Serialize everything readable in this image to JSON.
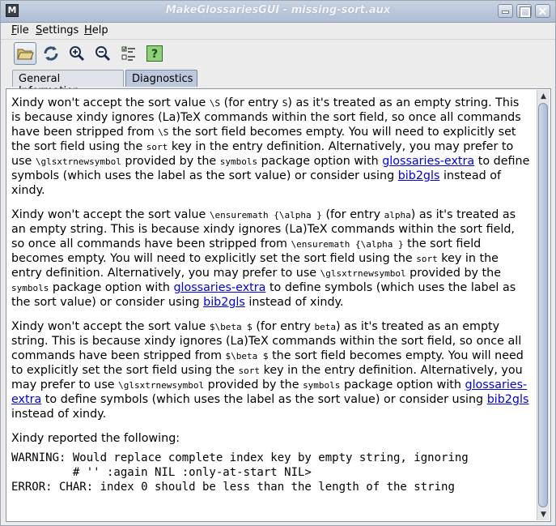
{
  "window": {
    "title": "MakeGlossariesGUI - missing-sort.aux",
    "app_icon": "M"
  },
  "menu": [
    {
      "label": "File",
      "mnemonic": "F",
      "rest": "ile"
    },
    {
      "label": "Settings",
      "mnemonic": "S",
      "rest": "ettings"
    },
    {
      "label": "Help",
      "mnemonic": "H",
      "rest": "elp"
    }
  ],
  "toolbar": {
    "icons": [
      "open-folder-icon",
      "reload-icon",
      "zoom-in-icon",
      "zoom-out-icon",
      "properties-icon",
      "help-icon"
    ],
    "help_glyph": "?"
  },
  "tabs": {
    "general": "General Information",
    "diagnostics": "Diagnostics"
  },
  "diagnostics": {
    "p1": {
      "a": "Xindy won't accept the sort value ",
      "c1": "\\S",
      "b": " (for entry ",
      "c2": "S",
      "c": ") as it's treated as an empty string. This is because xindy ignores (La)TeX commands within the sort field, so once all commands have been stripped from ",
      "c3": "\\S",
      "d": " the sort field becomes empty. You will need to explicitly set the sort field using the ",
      "c4": "sort",
      "e": " key in the entry definition. Alternatively, you may prefer to use ",
      "c5": "\\glsxtrnewsymbol",
      "f": " provided by the ",
      "c6": "symbols",
      "g": " package option with ",
      "link1": "glossaries-extra",
      "h": " to define symbols (which uses the label as the sort value) or consider using ",
      "link2": "bib2gls",
      "i": " instead of xindy."
    },
    "p2": {
      "a": "Xindy won't accept the sort value ",
      "c1": "\\ensuremath {\\alpha }",
      "b": " (for entry ",
      "c2": "alpha",
      "c": ") as it's treated as an empty string. This is because xindy ignores (La)TeX commands within the sort field, so once all commands have been stripped from ",
      "c3": "\\ensuremath {\\alpha }",
      "d": " the sort field becomes empty. You will need to explicitly set the sort field using the ",
      "c4": "sort",
      "e": " key in the entry definition. Alternatively, you may prefer to use ",
      "c5": "\\glsxtrnewsymbol",
      "f": " provided by the ",
      "c6": "symbols",
      "g": " package option with ",
      "link1": "glossaries-extra",
      "h": " to define symbols (which uses the label as the sort value) or consider using ",
      "link2": "bib2gls",
      "i": " instead of xindy."
    },
    "p3": {
      "a": "Xindy won't accept the sort value ",
      "c1": "$\\beta $",
      "b": " (for entry ",
      "c2": "beta",
      "c": ") as it's treated as an empty string. This is because xindy ignores (La)TeX commands within the sort field, so once all commands have been stripped from ",
      "c3": "$\\beta $",
      "d": " the sort field becomes empty. You will need to explicitly set the sort field using the ",
      "c4": "sort",
      "e": " key in the entry definition. Alternatively, you may prefer to use ",
      "c5": "\\glsxtrnewsymbol",
      "f": " provided by the ",
      "c6": "symbols",
      "g": " package option with ",
      "link1": "glossaries-extra",
      "h": " to define symbols (which uses the label as the sort value) or consider using ",
      "link2": "bib2gls",
      "i": " instead of xindy."
    },
    "xindy_heading": "Xindy reported the following:",
    "xindy_output": "WARNING: Would replace complete index key by empty string, ignoring\n         # '' :again NIL :only-at-start NIL>\nERROR: CHAR: index 0 should be less than the length of the string"
  }
}
